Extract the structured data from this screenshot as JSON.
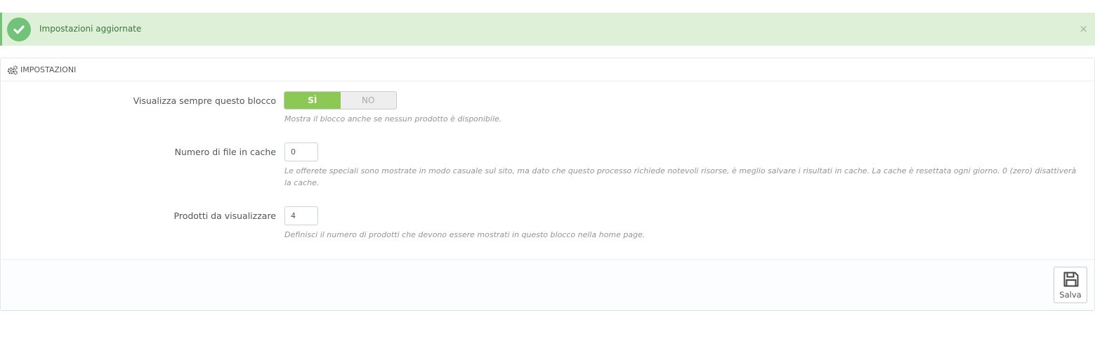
{
  "alert": {
    "message": "Impostazioni aggiornate",
    "close_label": "×",
    "icon": "check-circle-icon",
    "color": "#72c279"
  },
  "panel": {
    "title": "IMPOSTAZIONI",
    "icon": "cogs-icon"
  },
  "fields": {
    "always_display": {
      "label": "Visualizza sempre questo blocco",
      "yes_label": "SÌ",
      "no_label": "NO",
      "selected": "SÌ",
      "help": "Mostra il blocco anche se nessun prodotto è disponibile."
    },
    "cache_files": {
      "label": "Numero di file in cache",
      "value": "0",
      "help_line1": "Le offerete speciali sono mostrate in modo casuale sul sito, ma dato che questo processo richiede notevoli risorse, è meglio salvare i risultati in cache. La cache è resettata ogni giorno. 0 (zero) disattiverà",
      "help_line2": "la cache."
    },
    "products_count": {
      "label": "Prodotti da visualizzare",
      "value": "4",
      "help": "Definisci il numero di prodotti che devono essere mostrati in questo blocco nella home page."
    }
  },
  "footer": {
    "save_label": "Salva",
    "icon": "floppy-disk-icon"
  },
  "colors": {
    "switch_on": "#8bc954",
    "alert_bg": "#dff0d8"
  }
}
